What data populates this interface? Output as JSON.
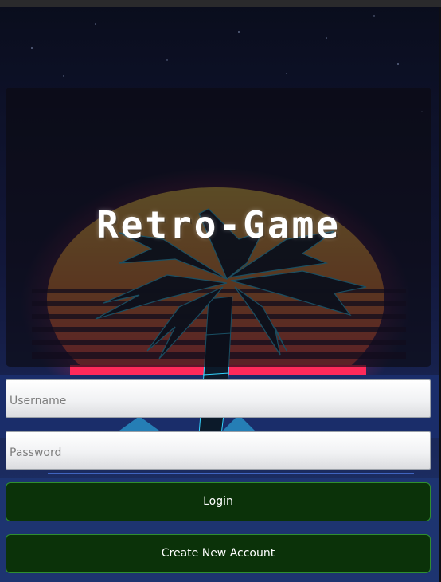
{
  "app": {
    "title": "Retro-Game"
  },
  "login_form": {
    "username_placeholder": "Username",
    "username_value": "",
    "password_placeholder": "Password",
    "password_value": "",
    "login_label": "Login",
    "create_account_label": "Create New Account"
  },
  "theme": {
    "background": "#101530",
    "sun_top": "#f4c04a",
    "sun_bottom": "#ff2a5a",
    "palm_edge": "#2fd0ff",
    "button_bg": "#0b3209",
    "button_border": "#2f8f2f"
  }
}
